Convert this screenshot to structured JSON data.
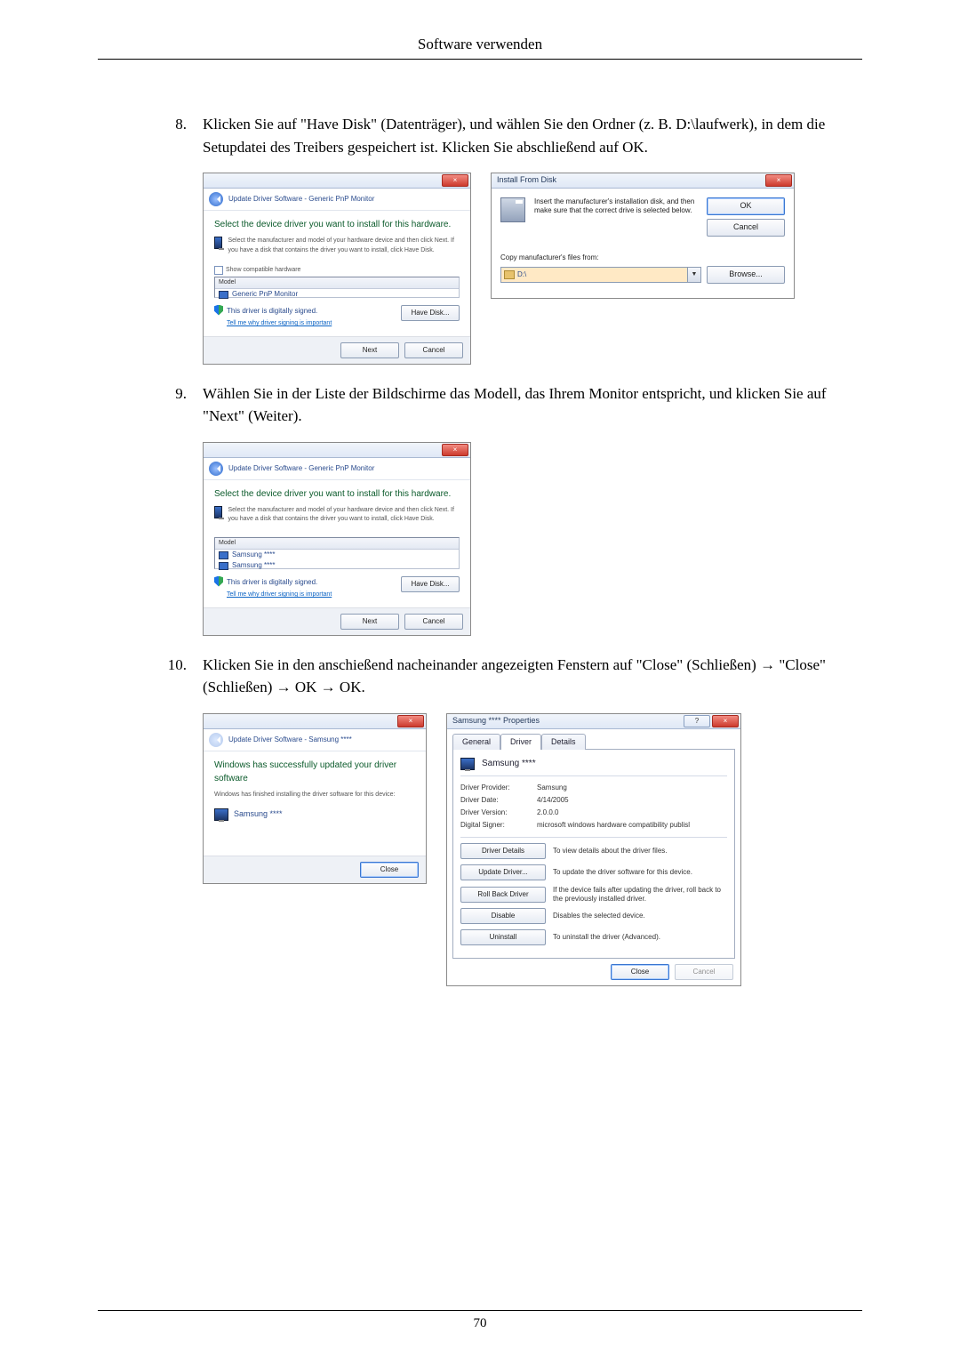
{
  "header": {
    "title": "Software verwenden"
  },
  "steps": {
    "s8": {
      "num": "8.",
      "text": "Klicken Sie auf \"Have Disk\" (Datenträger), und wählen Sie den Ordner (z. B. D:\\laufwerk), in dem die Setupdatei des Treibers gespeichert ist. Klicken Sie abschließend auf OK."
    },
    "s9": {
      "num": "9.",
      "text": "Wählen Sie in der Liste der Bildschirme das Modell, das Ihrem Monitor entspricht, und klicken Sie auf \"Next\" (Weiter)."
    },
    "s10": {
      "num": "10.",
      "text": "Klicken Sie in den anschießend nacheinander angezeigten Fenstern auf \"Close\" (Schließen) → \"Close\" (Schließen) → OK → OK."
    }
  },
  "win1": {
    "crumb": "Update Driver Software - Generic PnP Monitor",
    "heading": "Select the device driver you want to install for this hardware.",
    "info": "Select the manufacturer and model of your hardware device and then click Next. If you have a disk that contains the driver you want to install, click Have Disk.",
    "showCompat": "Show compatible hardware",
    "modelHdr": "Model",
    "model1": "Generic PnP Monitor",
    "signed": "This driver is digitally signed.",
    "signLink": "Tell me why driver signing is important",
    "haveDisk": "Have Disk...",
    "next": "Next",
    "cancel": "Cancel"
  },
  "ifd": {
    "title": "Install From Disk",
    "msg": "Insert the manufacturer's installation disk, and then make sure that the correct drive is selected below.",
    "ok": "OK",
    "cancel": "Cancel",
    "copyLabel": "Copy manufacturer's files from:",
    "path": "D:\\",
    "browse": "Browse..."
  },
  "win2": {
    "crumb": "Update Driver Software - Generic PnP Monitor",
    "heading": "Select the device driver you want to install for this hardware.",
    "info": "Select the manufacturer and model of your hardware device and then click Next. If you have a disk that contains the driver you want to install, click Have Disk.",
    "modelHdr": "Model",
    "model1": "Samsung ****",
    "model2": "Samsung ****",
    "signed": "This driver is digitally signed.",
    "signLink": "Tell me why driver signing is important",
    "haveDisk": "Have Disk...",
    "next": "Next",
    "cancel": "Cancel"
  },
  "win3": {
    "crumb": "Update Driver Software - Samsung ****",
    "heading": "Windows has successfully updated your driver software",
    "info": "Windows has finished installing the driver software for this device:",
    "device": "Samsung ****",
    "close": "Close"
  },
  "prop": {
    "title": "Samsung **** Properties",
    "tabGeneral": "General",
    "tabDriver": "Driver",
    "tabDetails": "Details",
    "device": "Samsung ****",
    "rows": {
      "provider": {
        "l": "Driver Provider:",
        "v": "Samsung"
      },
      "date": {
        "l": "Driver Date:",
        "v": "4/14/2005"
      },
      "version": {
        "l": "Driver Version:",
        "v": "2.0.0.0"
      },
      "signer": {
        "l": "Digital Signer:",
        "v": "microsoft windows hardware compatibility publisl"
      }
    },
    "actions": {
      "details": {
        "b": "Driver Details",
        "d": "To view details about the driver files."
      },
      "update": {
        "b": "Update Driver...",
        "d": "To update the driver software for this device."
      },
      "rollback": {
        "b": "Roll Back Driver",
        "d": "If the device fails after updating the driver, roll back to the previously installed driver."
      },
      "disable": {
        "b": "Disable",
        "d": "Disables the selected device."
      },
      "uninstall": {
        "b": "Uninstall",
        "d": "To uninstall the driver (Advanced)."
      }
    },
    "close": "Close",
    "cancel": "Cancel"
  },
  "footer": {
    "page": "70"
  }
}
